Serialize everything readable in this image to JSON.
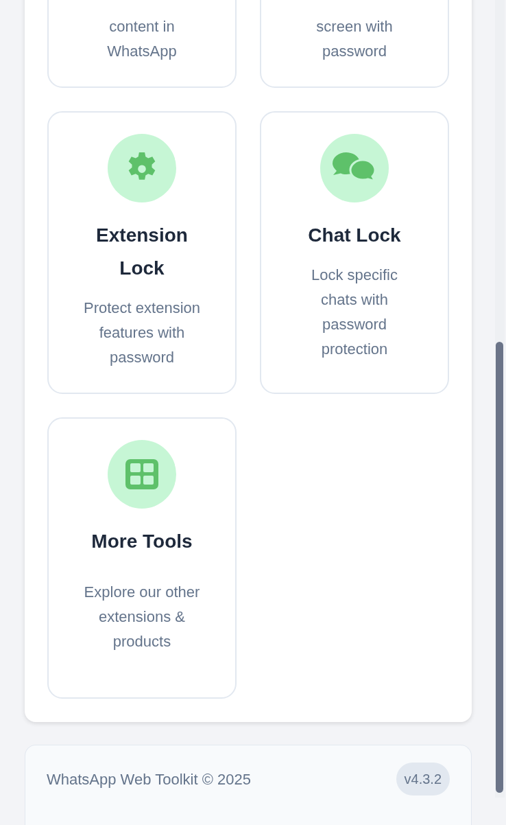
{
  "top_cards": [
    {
      "description": "content in WhatsApp"
    },
    {
      "description": "screen with password"
    }
  ],
  "cards": [
    {
      "title": "Extension Lock",
      "description": "Protect extension features with password"
    },
    {
      "title": "Chat Lock",
      "description": "Lock specific chats with password protection"
    },
    {
      "title": "More Tools",
      "description": "Explore our other extensions & products"
    }
  ],
  "footer": {
    "text": "WhatsApp Web Toolkit © 2025",
    "version": "v4.3.2"
  }
}
